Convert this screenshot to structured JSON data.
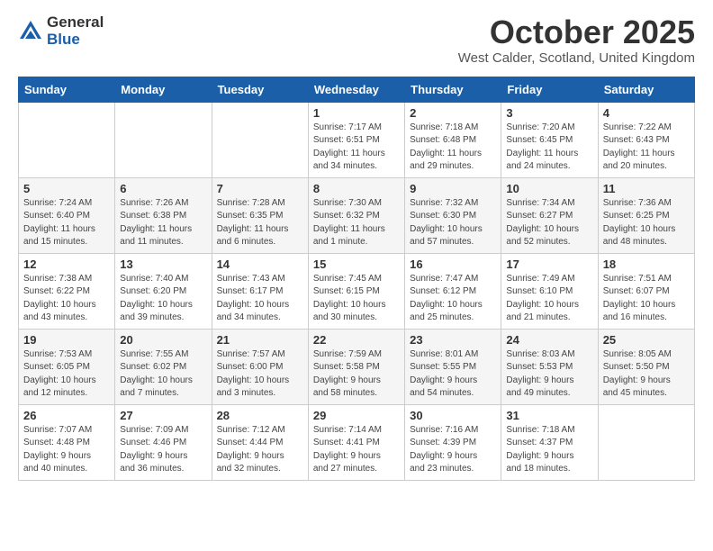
{
  "logo": {
    "general": "General",
    "blue": "Blue"
  },
  "header": {
    "month": "October 2025",
    "location": "West Calder, Scotland, United Kingdom"
  },
  "weekdays": [
    "Sunday",
    "Monday",
    "Tuesday",
    "Wednesday",
    "Thursday",
    "Friday",
    "Saturday"
  ],
  "weeks": [
    [
      {
        "day": "",
        "info": ""
      },
      {
        "day": "",
        "info": ""
      },
      {
        "day": "",
        "info": ""
      },
      {
        "day": "1",
        "info": "Sunrise: 7:17 AM\nSunset: 6:51 PM\nDaylight: 11 hours\nand 34 minutes."
      },
      {
        "day": "2",
        "info": "Sunrise: 7:18 AM\nSunset: 6:48 PM\nDaylight: 11 hours\nand 29 minutes."
      },
      {
        "day": "3",
        "info": "Sunrise: 7:20 AM\nSunset: 6:45 PM\nDaylight: 11 hours\nand 24 minutes."
      },
      {
        "day": "4",
        "info": "Sunrise: 7:22 AM\nSunset: 6:43 PM\nDaylight: 11 hours\nand 20 minutes."
      }
    ],
    [
      {
        "day": "5",
        "info": "Sunrise: 7:24 AM\nSunset: 6:40 PM\nDaylight: 11 hours\nand 15 minutes."
      },
      {
        "day": "6",
        "info": "Sunrise: 7:26 AM\nSunset: 6:38 PM\nDaylight: 11 hours\nand 11 minutes."
      },
      {
        "day": "7",
        "info": "Sunrise: 7:28 AM\nSunset: 6:35 PM\nDaylight: 11 hours\nand 6 minutes."
      },
      {
        "day": "8",
        "info": "Sunrise: 7:30 AM\nSunset: 6:32 PM\nDaylight: 11 hours\nand 1 minute."
      },
      {
        "day": "9",
        "info": "Sunrise: 7:32 AM\nSunset: 6:30 PM\nDaylight: 10 hours\nand 57 minutes."
      },
      {
        "day": "10",
        "info": "Sunrise: 7:34 AM\nSunset: 6:27 PM\nDaylight: 10 hours\nand 52 minutes."
      },
      {
        "day": "11",
        "info": "Sunrise: 7:36 AM\nSunset: 6:25 PM\nDaylight: 10 hours\nand 48 minutes."
      }
    ],
    [
      {
        "day": "12",
        "info": "Sunrise: 7:38 AM\nSunset: 6:22 PM\nDaylight: 10 hours\nand 43 minutes."
      },
      {
        "day": "13",
        "info": "Sunrise: 7:40 AM\nSunset: 6:20 PM\nDaylight: 10 hours\nand 39 minutes."
      },
      {
        "day": "14",
        "info": "Sunrise: 7:43 AM\nSunset: 6:17 PM\nDaylight: 10 hours\nand 34 minutes."
      },
      {
        "day": "15",
        "info": "Sunrise: 7:45 AM\nSunset: 6:15 PM\nDaylight: 10 hours\nand 30 minutes."
      },
      {
        "day": "16",
        "info": "Sunrise: 7:47 AM\nSunset: 6:12 PM\nDaylight: 10 hours\nand 25 minutes."
      },
      {
        "day": "17",
        "info": "Sunrise: 7:49 AM\nSunset: 6:10 PM\nDaylight: 10 hours\nand 21 minutes."
      },
      {
        "day": "18",
        "info": "Sunrise: 7:51 AM\nSunset: 6:07 PM\nDaylight: 10 hours\nand 16 minutes."
      }
    ],
    [
      {
        "day": "19",
        "info": "Sunrise: 7:53 AM\nSunset: 6:05 PM\nDaylight: 10 hours\nand 12 minutes."
      },
      {
        "day": "20",
        "info": "Sunrise: 7:55 AM\nSunset: 6:02 PM\nDaylight: 10 hours\nand 7 minutes."
      },
      {
        "day": "21",
        "info": "Sunrise: 7:57 AM\nSunset: 6:00 PM\nDaylight: 10 hours\nand 3 minutes."
      },
      {
        "day": "22",
        "info": "Sunrise: 7:59 AM\nSunset: 5:58 PM\nDaylight: 9 hours\nand 58 minutes."
      },
      {
        "day": "23",
        "info": "Sunrise: 8:01 AM\nSunset: 5:55 PM\nDaylight: 9 hours\nand 54 minutes."
      },
      {
        "day": "24",
        "info": "Sunrise: 8:03 AM\nSunset: 5:53 PM\nDaylight: 9 hours\nand 49 minutes."
      },
      {
        "day": "25",
        "info": "Sunrise: 8:05 AM\nSunset: 5:50 PM\nDaylight: 9 hours\nand 45 minutes."
      }
    ],
    [
      {
        "day": "26",
        "info": "Sunrise: 7:07 AM\nSunset: 4:48 PM\nDaylight: 9 hours\nand 40 minutes."
      },
      {
        "day": "27",
        "info": "Sunrise: 7:09 AM\nSunset: 4:46 PM\nDaylight: 9 hours\nand 36 minutes."
      },
      {
        "day": "28",
        "info": "Sunrise: 7:12 AM\nSunset: 4:44 PM\nDaylight: 9 hours\nand 32 minutes."
      },
      {
        "day": "29",
        "info": "Sunrise: 7:14 AM\nSunset: 4:41 PM\nDaylight: 9 hours\nand 27 minutes."
      },
      {
        "day": "30",
        "info": "Sunrise: 7:16 AM\nSunset: 4:39 PM\nDaylight: 9 hours\nand 23 minutes."
      },
      {
        "day": "31",
        "info": "Sunrise: 7:18 AM\nSunset: 4:37 PM\nDaylight: 9 hours\nand 18 minutes."
      },
      {
        "day": "",
        "info": ""
      }
    ]
  ]
}
